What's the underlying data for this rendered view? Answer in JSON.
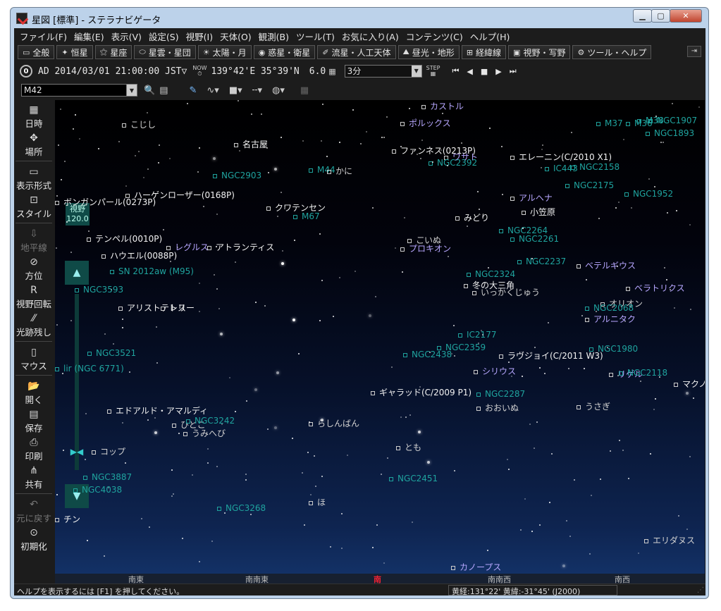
{
  "window": {
    "title": "星図 [標準] - ステラナビゲータ"
  },
  "menu": [
    "ファイル(F)",
    "編集(E)",
    "表示(V)",
    "設定(S)",
    "視野(I)",
    "天体(O)",
    "観測(B)",
    "ツール(T)",
    "お気に入り(A)",
    "コンテンツ(C)",
    "ヘルプ(H)"
  ],
  "tabs": [
    {
      "icon": "▭",
      "label": "全般"
    },
    {
      "icon": "✦",
      "label": "恒星"
    },
    {
      "icon": "⚝",
      "label": "星座"
    },
    {
      "icon": "⬭",
      "label": "星雲・星団"
    },
    {
      "icon": "☀",
      "label": "太陽・月"
    },
    {
      "icon": "◉",
      "label": "惑星・衛星"
    },
    {
      "icon": "✐",
      "label": "流星・人工天体"
    },
    {
      "icon": "⛰",
      "label": "昼光・地形"
    },
    {
      "icon": "⊞",
      "label": "経緯線"
    },
    {
      "icon": "▣",
      "label": "視野・写野"
    },
    {
      "icon": "⚙",
      "label": "ツール・ヘルプ"
    }
  ],
  "time": {
    "era_button": "0",
    "datetime": "AD 2014/03/01 21:00:00 JST▽",
    "now_label": "NOW",
    "location": "139°42'E 35°39'N",
    "magnitude": "6.0",
    "step": "3分",
    "step_label": "STEP"
  },
  "search": {
    "value": "M42"
  },
  "left_tools": [
    {
      "icon": "▦",
      "label": "日時",
      "dim": false
    },
    {
      "icon": "✥",
      "label": "場所",
      "dim": false
    },
    {
      "icon": "▭",
      "label": "表示形式",
      "dim": false
    },
    {
      "icon": "⊡",
      "label": "スタイル",
      "dim": false
    },
    {
      "icon": "⇩",
      "label": "地平線",
      "dim": true
    },
    {
      "icon": "⊘",
      "label": "方位",
      "dim": false
    },
    {
      "icon": "R",
      "label": "視野回転",
      "dim": false
    },
    {
      "icon": "⁄⁄",
      "label": "光跡残し",
      "dim": false
    },
    {
      "icon": "▯",
      "label": "マウス",
      "dim": false
    },
    {
      "icon": "📂",
      "label": "開く",
      "dim": false
    },
    {
      "icon": "▤",
      "label": "保存",
      "dim": false
    },
    {
      "icon": "⎙",
      "label": "印刷",
      "dim": false
    },
    {
      "icon": "⋔",
      "label": "共有",
      "dim": false
    },
    {
      "icon": "↶",
      "label": "元に戻す",
      "dim": true
    },
    {
      "icon": "⊙",
      "label": "初期化",
      "dim": false
    }
  ],
  "zoom": {
    "label": "視野",
    "value": "120.0"
  },
  "sky_labels": [
    {
      "text": "カストル",
      "color": "blue"
    },
    {
      "text": "ポルックス",
      "color": "blue"
    },
    {
      "text": "こじし",
      "color": "gray"
    },
    {
      "text": "名古屋",
      "color": "white"
    },
    {
      "text": "ファンネス(0213P)",
      "color": "white"
    },
    {
      "text": "ワサト",
      "color": "blue"
    },
    {
      "text": "NGC2392",
      "color": "cyan"
    },
    {
      "text": "エレーニン(C/2010 X1)",
      "color": "white"
    },
    {
      "text": "IC443",
      "color": "cyan"
    },
    {
      "text": "NGC2158",
      "color": "cyan"
    },
    {
      "text": "M37",
      "color": "cyan"
    },
    {
      "text": "M36",
      "color": "cyan"
    },
    {
      "text": "M38",
      "color": "cyan"
    },
    {
      "text": "NGC1907",
      "color": "cyan"
    },
    {
      "text": "NGC1893",
      "color": "cyan"
    },
    {
      "text": "NGC2903",
      "color": "cyan"
    },
    {
      "text": "M44",
      "color": "cyan"
    },
    {
      "text": "かに",
      "color": "gray"
    },
    {
      "text": "NGC2175",
      "color": "cyan"
    },
    {
      "text": "NGC1952",
      "color": "cyan"
    },
    {
      "text": "アルヘナ",
      "color": "blue"
    },
    {
      "text": "ハーゲンローザー(0168P)",
      "color": "white"
    },
    {
      "text": "ボンガンパール(0273P)",
      "color": "white"
    },
    {
      "text": "クワテンセン",
      "color": "white"
    },
    {
      "text": "M67",
      "color": "cyan"
    },
    {
      "text": "みどり",
      "color": "white"
    },
    {
      "text": "小笠原",
      "color": "white"
    },
    {
      "text": "テンペル(0010P)",
      "color": "white"
    },
    {
      "text": "レグルス",
      "color": "blue"
    },
    {
      "text": "アトランティス",
      "color": "white"
    },
    {
      "text": "ハウエル(0088P)",
      "color": "white"
    },
    {
      "text": "プロキオン",
      "color": "blue"
    },
    {
      "text": "こいぬ",
      "color": "gray"
    },
    {
      "text": "NGC2264",
      "color": "cyan"
    },
    {
      "text": "NGC2261",
      "color": "cyan"
    },
    {
      "text": "NGC2237",
      "color": "cyan"
    },
    {
      "text": "ベテルギウス",
      "color": "blue"
    },
    {
      "text": "SN 2012aw (M95)",
      "color": "cyan"
    },
    {
      "text": "NGC2324",
      "color": "cyan"
    },
    {
      "text": "冬の大三角",
      "color": "white"
    },
    {
      "text": "いっかくじゅう",
      "color": "gray"
    },
    {
      "text": "ベラトリクス",
      "color": "blue"
    },
    {
      "text": "NGC3593",
      "color": "cyan"
    },
    {
      "text": "アリストテレス",
      "color": "white"
    },
    {
      "text": "トリー",
      "color": "white"
    },
    {
      "text": "オリオン",
      "color": "gray"
    },
    {
      "text": "NGC2068",
      "color": "cyan"
    },
    {
      "text": "アルニタク",
      "color": "blue"
    },
    {
      "text": "IC2177",
      "color": "cyan"
    },
    {
      "text": "NGC2359",
      "color": "cyan"
    },
    {
      "text": "NGC2438",
      "color": "cyan"
    },
    {
      "text": "ラヴジョイ(C/2011 W3)",
      "color": "white"
    },
    {
      "text": "NGC1980",
      "color": "cyan"
    },
    {
      "text": "NGC3521",
      "color": "cyan"
    },
    {
      "text": "lir (NGC 6771)",
      "color": "cyan"
    },
    {
      "text": "シリウス",
      "color": "blue"
    },
    {
      "text": "リゲル",
      "color": "blue"
    },
    {
      "text": "NGC2118",
      "color": "cyan"
    },
    {
      "text": "マクノ",
      "color": "white"
    },
    {
      "text": "ギャラッド(C/2009 P1)",
      "color": "white"
    },
    {
      "text": "NGC2287",
      "color": "cyan"
    },
    {
      "text": "おおいぬ",
      "color": "gray"
    },
    {
      "text": "うさぎ",
      "color": "gray"
    },
    {
      "text": "エドアルド・アマルディ",
      "color": "white"
    },
    {
      "text": "ひとこ",
      "color": "gray"
    },
    {
      "text": "NGC3242",
      "color": "cyan"
    },
    {
      "text": "うみへび",
      "color": "gray"
    },
    {
      "text": "らしんばん",
      "color": "gray"
    },
    {
      "text": "コップ",
      "color": "gray"
    },
    {
      "text": "とも",
      "color": "gray"
    },
    {
      "text": "NGC3887",
      "color": "cyan"
    },
    {
      "text": "NGC2451",
      "color": "cyan"
    },
    {
      "text": "NGC4038",
      "color": "cyan"
    },
    {
      "text": "NGC3268",
      "color": "cyan"
    },
    {
      "text": "ほ",
      "color": "gray"
    },
    {
      "text": "チン",
      "color": "white"
    },
    {
      "text": "エリダヌス",
      "color": "gray"
    },
    {
      "text": "カノープス",
      "color": "blue"
    }
  ],
  "compass": [
    {
      "text": "南東",
      "main": false
    },
    {
      "text": "南南東",
      "main": false
    },
    {
      "text": "南",
      "main": true
    },
    {
      "text": "南南西",
      "main": false
    },
    {
      "text": "南西",
      "main": false
    }
  ],
  "status": {
    "help": "ヘルプを表示するには [F1] を押してください。",
    "coords": "黄経:131°22' 黄緯:-31°45' (J2000)"
  }
}
